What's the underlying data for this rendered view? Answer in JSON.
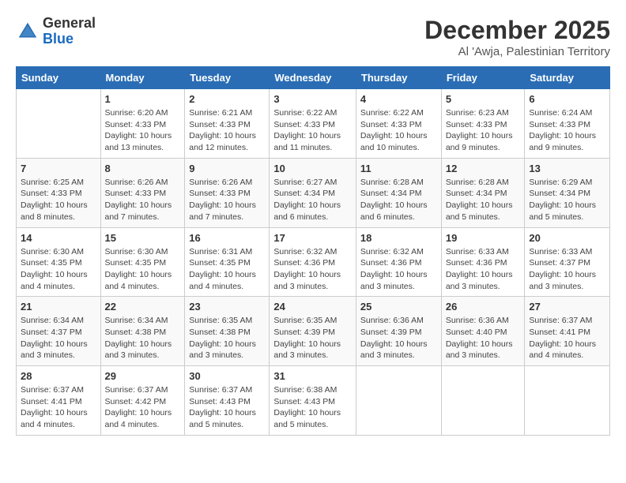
{
  "logo": {
    "general": "General",
    "blue": "Blue"
  },
  "title": "December 2025",
  "subtitle": "Al 'Awja, Palestinian Territory",
  "days_of_week": [
    "Sunday",
    "Monday",
    "Tuesday",
    "Wednesday",
    "Thursday",
    "Friday",
    "Saturday"
  ],
  "weeks": [
    [
      {
        "day": "",
        "info": ""
      },
      {
        "day": "1",
        "info": "Sunrise: 6:20 AM\nSunset: 4:33 PM\nDaylight: 10 hours\nand 13 minutes."
      },
      {
        "day": "2",
        "info": "Sunrise: 6:21 AM\nSunset: 4:33 PM\nDaylight: 10 hours\nand 12 minutes."
      },
      {
        "day": "3",
        "info": "Sunrise: 6:22 AM\nSunset: 4:33 PM\nDaylight: 10 hours\nand 11 minutes."
      },
      {
        "day": "4",
        "info": "Sunrise: 6:22 AM\nSunset: 4:33 PM\nDaylight: 10 hours\nand 10 minutes."
      },
      {
        "day": "5",
        "info": "Sunrise: 6:23 AM\nSunset: 4:33 PM\nDaylight: 10 hours\nand 9 minutes."
      },
      {
        "day": "6",
        "info": "Sunrise: 6:24 AM\nSunset: 4:33 PM\nDaylight: 10 hours\nand 9 minutes."
      }
    ],
    [
      {
        "day": "7",
        "info": "Sunrise: 6:25 AM\nSunset: 4:33 PM\nDaylight: 10 hours\nand 8 minutes."
      },
      {
        "day": "8",
        "info": "Sunrise: 6:26 AM\nSunset: 4:33 PM\nDaylight: 10 hours\nand 7 minutes."
      },
      {
        "day": "9",
        "info": "Sunrise: 6:26 AM\nSunset: 4:33 PM\nDaylight: 10 hours\nand 7 minutes."
      },
      {
        "day": "10",
        "info": "Sunrise: 6:27 AM\nSunset: 4:34 PM\nDaylight: 10 hours\nand 6 minutes."
      },
      {
        "day": "11",
        "info": "Sunrise: 6:28 AM\nSunset: 4:34 PM\nDaylight: 10 hours\nand 6 minutes."
      },
      {
        "day": "12",
        "info": "Sunrise: 6:28 AM\nSunset: 4:34 PM\nDaylight: 10 hours\nand 5 minutes."
      },
      {
        "day": "13",
        "info": "Sunrise: 6:29 AM\nSunset: 4:34 PM\nDaylight: 10 hours\nand 5 minutes."
      }
    ],
    [
      {
        "day": "14",
        "info": "Sunrise: 6:30 AM\nSunset: 4:35 PM\nDaylight: 10 hours\nand 4 minutes."
      },
      {
        "day": "15",
        "info": "Sunrise: 6:30 AM\nSunset: 4:35 PM\nDaylight: 10 hours\nand 4 minutes."
      },
      {
        "day": "16",
        "info": "Sunrise: 6:31 AM\nSunset: 4:35 PM\nDaylight: 10 hours\nand 4 minutes."
      },
      {
        "day": "17",
        "info": "Sunrise: 6:32 AM\nSunset: 4:36 PM\nDaylight: 10 hours\nand 3 minutes."
      },
      {
        "day": "18",
        "info": "Sunrise: 6:32 AM\nSunset: 4:36 PM\nDaylight: 10 hours\nand 3 minutes."
      },
      {
        "day": "19",
        "info": "Sunrise: 6:33 AM\nSunset: 4:36 PM\nDaylight: 10 hours\nand 3 minutes."
      },
      {
        "day": "20",
        "info": "Sunrise: 6:33 AM\nSunset: 4:37 PM\nDaylight: 10 hours\nand 3 minutes."
      }
    ],
    [
      {
        "day": "21",
        "info": "Sunrise: 6:34 AM\nSunset: 4:37 PM\nDaylight: 10 hours\nand 3 minutes."
      },
      {
        "day": "22",
        "info": "Sunrise: 6:34 AM\nSunset: 4:38 PM\nDaylight: 10 hours\nand 3 minutes."
      },
      {
        "day": "23",
        "info": "Sunrise: 6:35 AM\nSunset: 4:38 PM\nDaylight: 10 hours\nand 3 minutes."
      },
      {
        "day": "24",
        "info": "Sunrise: 6:35 AM\nSunset: 4:39 PM\nDaylight: 10 hours\nand 3 minutes."
      },
      {
        "day": "25",
        "info": "Sunrise: 6:36 AM\nSunset: 4:39 PM\nDaylight: 10 hours\nand 3 minutes."
      },
      {
        "day": "26",
        "info": "Sunrise: 6:36 AM\nSunset: 4:40 PM\nDaylight: 10 hours\nand 3 minutes."
      },
      {
        "day": "27",
        "info": "Sunrise: 6:37 AM\nSunset: 4:41 PM\nDaylight: 10 hours\nand 4 minutes."
      }
    ],
    [
      {
        "day": "28",
        "info": "Sunrise: 6:37 AM\nSunset: 4:41 PM\nDaylight: 10 hours\nand 4 minutes."
      },
      {
        "day": "29",
        "info": "Sunrise: 6:37 AM\nSunset: 4:42 PM\nDaylight: 10 hours\nand 4 minutes."
      },
      {
        "day": "30",
        "info": "Sunrise: 6:37 AM\nSunset: 4:43 PM\nDaylight: 10 hours\nand 5 minutes."
      },
      {
        "day": "31",
        "info": "Sunrise: 6:38 AM\nSunset: 4:43 PM\nDaylight: 10 hours\nand 5 minutes."
      },
      {
        "day": "",
        "info": ""
      },
      {
        "day": "",
        "info": ""
      },
      {
        "day": "",
        "info": ""
      }
    ]
  ]
}
